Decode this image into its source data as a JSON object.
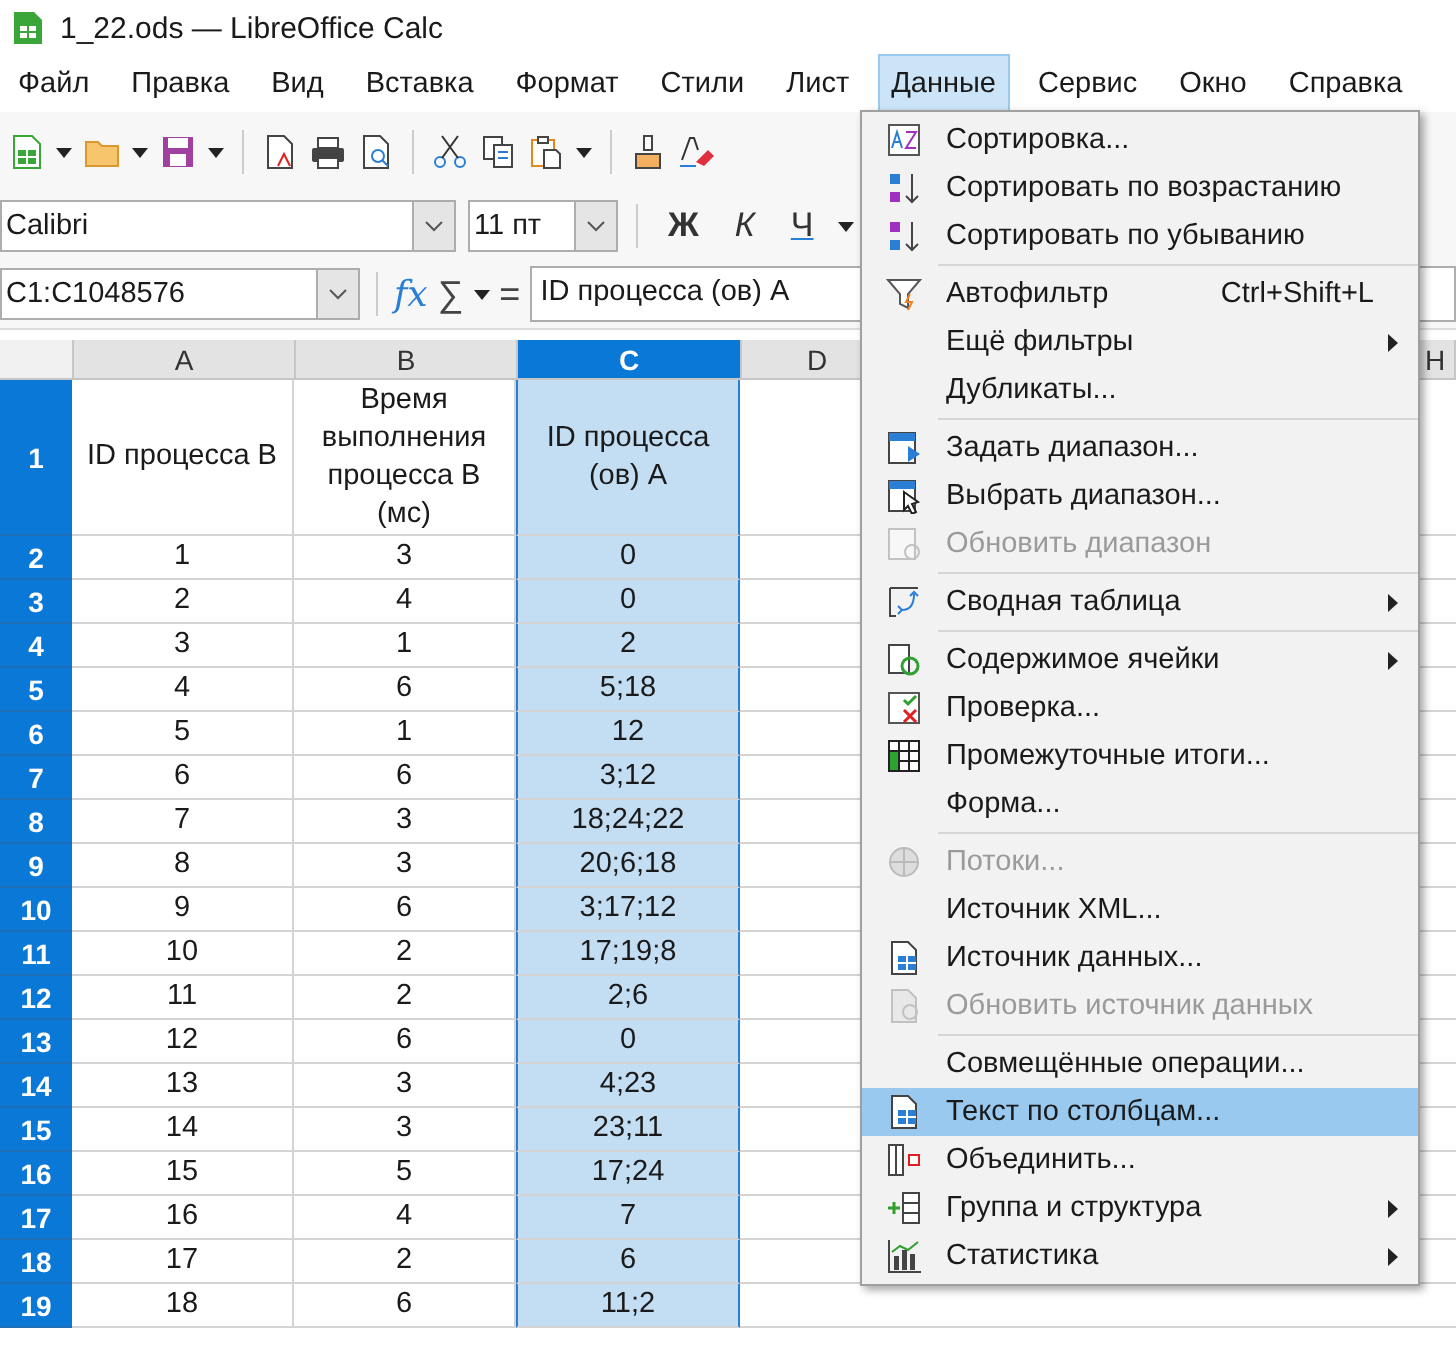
{
  "window": {
    "title": "1_22.ods — LibreOffice Calc"
  },
  "menu_bar": [
    {
      "label": "Файл",
      "selected": false
    },
    {
      "label": "Правка",
      "selected": false
    },
    {
      "label": "Вид",
      "selected": false
    },
    {
      "label": "Вставка",
      "selected": false
    },
    {
      "label": "Формат",
      "selected": false
    },
    {
      "label": "Стили",
      "selected": false
    },
    {
      "label": "Лист",
      "selected": false
    },
    {
      "label": "Данные",
      "selected": true
    },
    {
      "label": "Сервис",
      "selected": false
    },
    {
      "label": "Окно",
      "selected": false
    },
    {
      "label": "Справка",
      "selected": false
    }
  ],
  "format_bar": {
    "font_name": "Calibri",
    "font_size": "11 пт",
    "bold": "Ж",
    "italic": "К",
    "underline": "Ч"
  },
  "formula_bar": {
    "name_box": "C1:C1048576",
    "function_button": "fx",
    "sum": "∑",
    "equals": "=",
    "value": "ID процесса (ов) А"
  },
  "sheet": {
    "columns": [
      {
        "label": "A",
        "selected": false
      },
      {
        "label": "B",
        "selected": false
      },
      {
        "label": "C",
        "selected": true
      },
      {
        "label": "D",
        "selected": false
      },
      {
        "label": "H",
        "selected": false
      }
    ],
    "rows": [
      {
        "header": "1",
        "selected": true,
        "cells": [
          "ID процесса В",
          "Время выполнения процесса В (мс)",
          "ID процесса (ов) А"
        ]
      },
      {
        "header": "2",
        "selected": true,
        "cells": [
          "1",
          "3",
          "0"
        ]
      },
      {
        "header": "3",
        "selected": true,
        "cells": [
          "2",
          "4",
          "0"
        ]
      },
      {
        "header": "4",
        "selected": true,
        "cells": [
          "3",
          "1",
          "2"
        ]
      },
      {
        "header": "5",
        "selected": true,
        "cells": [
          "4",
          "6",
          "5;18"
        ]
      },
      {
        "header": "6",
        "selected": true,
        "cells": [
          "5",
          "1",
          "12"
        ]
      },
      {
        "header": "7",
        "selected": true,
        "cells": [
          "6",
          "6",
          "3;12"
        ]
      },
      {
        "header": "8",
        "selected": true,
        "cells": [
          "7",
          "3",
          "18;24;22"
        ]
      },
      {
        "header": "9",
        "selected": true,
        "cells": [
          "8",
          "3",
          "20;6;18"
        ]
      },
      {
        "header": "10",
        "selected": true,
        "cells": [
          "9",
          "6",
          "3;17;12"
        ]
      },
      {
        "header": "11",
        "selected": true,
        "cells": [
          "10",
          "2",
          "17;19;8"
        ]
      },
      {
        "header": "12",
        "selected": true,
        "cells": [
          "11",
          "2",
          "2;6"
        ]
      },
      {
        "header": "13",
        "selected": true,
        "cells": [
          "12",
          "6",
          "0"
        ]
      },
      {
        "header": "14",
        "selected": true,
        "cells": [
          "13",
          "3",
          "4;23"
        ]
      },
      {
        "header": "15",
        "selected": true,
        "cells": [
          "14",
          "3",
          "23;11"
        ]
      },
      {
        "header": "16",
        "selected": true,
        "cells": [
          "15",
          "5",
          "17;24"
        ]
      },
      {
        "header": "17",
        "selected": true,
        "cells": [
          "16",
          "4",
          "7"
        ]
      },
      {
        "header": "18",
        "selected": true,
        "cells": [
          "17",
          "2",
          "6"
        ]
      },
      {
        "header": "19",
        "selected": true,
        "cells": [
          "18",
          "6",
          "11;2"
        ]
      }
    ]
  },
  "data_menu": [
    {
      "kind": "item",
      "label": "Сортировка...",
      "disabled": false,
      "submenu": false,
      "selected": false
    },
    {
      "kind": "item",
      "label": "Сортировать по возрастанию",
      "disabled": false,
      "submenu": false,
      "selected": false
    },
    {
      "kind": "item",
      "label": "Сортировать по убыванию",
      "disabled": false,
      "submenu": false,
      "selected": false
    },
    {
      "kind": "separator"
    },
    {
      "kind": "item",
      "label": "Автофильтр",
      "shortcut": "Ctrl+Shift+L",
      "disabled": false,
      "submenu": false,
      "selected": false
    },
    {
      "kind": "item",
      "label": "Ещё фильтры",
      "disabled": false,
      "submenu": true,
      "selected": false
    },
    {
      "kind": "item",
      "label": "Дубликаты...",
      "disabled": false,
      "submenu": false,
      "selected": false
    },
    {
      "kind": "separator"
    },
    {
      "kind": "item",
      "label": "Задать диапазон...",
      "disabled": false,
      "submenu": false,
      "selected": false
    },
    {
      "kind": "item",
      "label": "Выбрать диапазон...",
      "disabled": false,
      "submenu": false,
      "selected": false
    },
    {
      "kind": "item",
      "label": "Обновить диапазон",
      "disabled": true,
      "submenu": false,
      "selected": false
    },
    {
      "kind": "separator"
    },
    {
      "kind": "item",
      "label": "Сводная таблица",
      "disabled": false,
      "submenu": true,
      "selected": false
    },
    {
      "kind": "separator"
    },
    {
      "kind": "item",
      "label": "Содержимое ячейки",
      "disabled": false,
      "submenu": true,
      "selected": false
    },
    {
      "kind": "item",
      "label": "Проверка...",
      "disabled": false,
      "submenu": false,
      "selected": false
    },
    {
      "kind": "item",
      "label": "Промежуточные итоги...",
      "disabled": false,
      "submenu": false,
      "selected": false
    },
    {
      "kind": "item",
      "label": "Форма...",
      "disabled": false,
      "submenu": false,
      "selected": false
    },
    {
      "kind": "separator"
    },
    {
      "kind": "item",
      "label": "Потоки...",
      "disabled": true,
      "submenu": false,
      "selected": false
    },
    {
      "kind": "item",
      "label": "Источник XML...",
      "disabled": false,
      "submenu": false,
      "selected": false
    },
    {
      "kind": "item",
      "label": "Источник данных...",
      "disabled": false,
      "submenu": false,
      "selected": false
    },
    {
      "kind": "item",
      "label": "Обновить источник данных",
      "disabled": true,
      "submenu": false,
      "selected": false
    },
    {
      "kind": "separator"
    },
    {
      "kind": "item",
      "label": "Совмещённые операции...",
      "disabled": false,
      "submenu": false,
      "selected": false
    },
    {
      "kind": "item",
      "label": "Текст по столбцам...",
      "disabled": false,
      "submenu": false,
      "selected": true
    },
    {
      "kind": "item",
      "label": "Объединить...",
      "disabled": false,
      "submenu": false,
      "selected": false
    },
    {
      "kind": "item",
      "label": "Группа и структура",
      "disabled": false,
      "submenu": true,
      "selected": false
    },
    {
      "kind": "item",
      "label": "Статистика",
      "disabled": false,
      "submenu": true,
      "selected": false
    }
  ]
}
